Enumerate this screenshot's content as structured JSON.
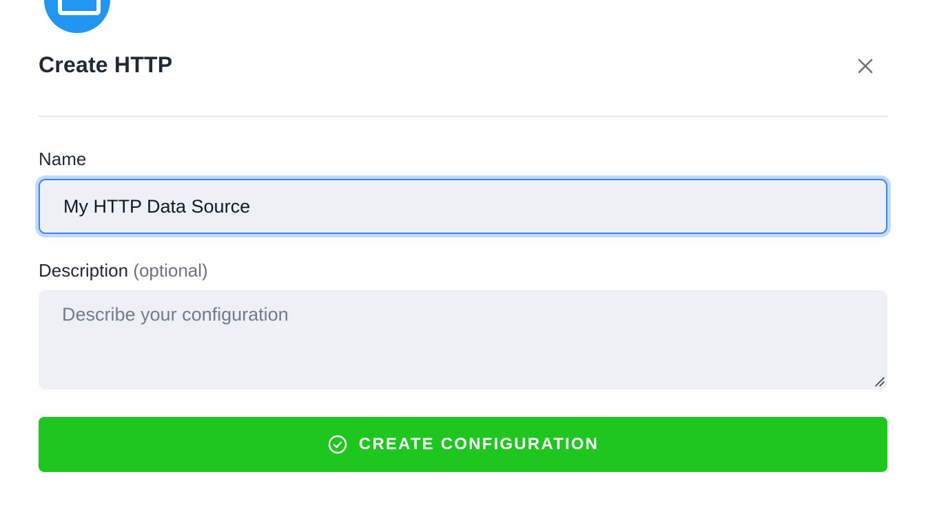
{
  "dialog": {
    "title": "Create HTTP",
    "close_icon": "close-icon",
    "header_icon": "http-datasource-icon",
    "accent_color": "#2196f3"
  },
  "form": {
    "name": {
      "label": "Name",
      "value": "My HTTP Data Source"
    },
    "description": {
      "label": "Description",
      "optional_label": "(optional)",
      "value": "",
      "placeholder": "Describe your configuration"
    }
  },
  "actions": {
    "create_label": "CREATE CONFIGURATION",
    "create_icon": "check-circle-icon",
    "create_color": "#1ec71e"
  }
}
